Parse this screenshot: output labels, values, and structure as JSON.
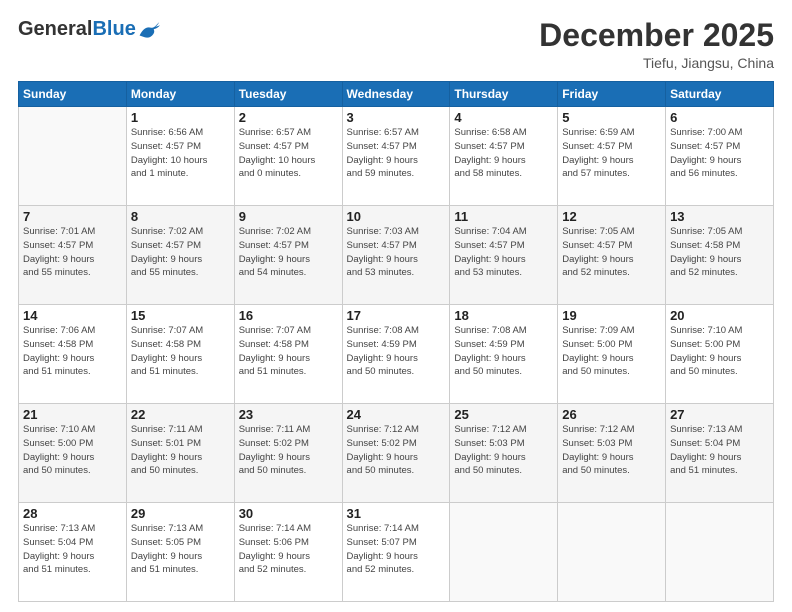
{
  "header": {
    "logo_general": "General",
    "logo_blue": "Blue",
    "month_title": "December 2025",
    "location": "Tiefu, Jiangsu, China"
  },
  "weekdays": [
    "Sunday",
    "Monday",
    "Tuesday",
    "Wednesday",
    "Thursday",
    "Friday",
    "Saturday"
  ],
  "weeks": [
    [
      {
        "num": "",
        "info": ""
      },
      {
        "num": "1",
        "info": "Sunrise: 6:56 AM\nSunset: 4:57 PM\nDaylight: 10 hours\nand 1 minute."
      },
      {
        "num": "2",
        "info": "Sunrise: 6:57 AM\nSunset: 4:57 PM\nDaylight: 10 hours\nand 0 minutes."
      },
      {
        "num": "3",
        "info": "Sunrise: 6:57 AM\nSunset: 4:57 PM\nDaylight: 9 hours\nand 59 minutes."
      },
      {
        "num": "4",
        "info": "Sunrise: 6:58 AM\nSunset: 4:57 PM\nDaylight: 9 hours\nand 58 minutes."
      },
      {
        "num": "5",
        "info": "Sunrise: 6:59 AM\nSunset: 4:57 PM\nDaylight: 9 hours\nand 57 minutes."
      },
      {
        "num": "6",
        "info": "Sunrise: 7:00 AM\nSunset: 4:57 PM\nDaylight: 9 hours\nand 56 minutes."
      }
    ],
    [
      {
        "num": "7",
        "info": "Sunrise: 7:01 AM\nSunset: 4:57 PM\nDaylight: 9 hours\nand 55 minutes."
      },
      {
        "num": "8",
        "info": "Sunrise: 7:02 AM\nSunset: 4:57 PM\nDaylight: 9 hours\nand 55 minutes."
      },
      {
        "num": "9",
        "info": "Sunrise: 7:02 AM\nSunset: 4:57 PM\nDaylight: 9 hours\nand 54 minutes."
      },
      {
        "num": "10",
        "info": "Sunrise: 7:03 AM\nSunset: 4:57 PM\nDaylight: 9 hours\nand 53 minutes."
      },
      {
        "num": "11",
        "info": "Sunrise: 7:04 AM\nSunset: 4:57 PM\nDaylight: 9 hours\nand 53 minutes."
      },
      {
        "num": "12",
        "info": "Sunrise: 7:05 AM\nSunset: 4:57 PM\nDaylight: 9 hours\nand 52 minutes."
      },
      {
        "num": "13",
        "info": "Sunrise: 7:05 AM\nSunset: 4:58 PM\nDaylight: 9 hours\nand 52 minutes."
      }
    ],
    [
      {
        "num": "14",
        "info": "Sunrise: 7:06 AM\nSunset: 4:58 PM\nDaylight: 9 hours\nand 51 minutes."
      },
      {
        "num": "15",
        "info": "Sunrise: 7:07 AM\nSunset: 4:58 PM\nDaylight: 9 hours\nand 51 minutes."
      },
      {
        "num": "16",
        "info": "Sunrise: 7:07 AM\nSunset: 4:58 PM\nDaylight: 9 hours\nand 51 minutes."
      },
      {
        "num": "17",
        "info": "Sunrise: 7:08 AM\nSunset: 4:59 PM\nDaylight: 9 hours\nand 50 minutes."
      },
      {
        "num": "18",
        "info": "Sunrise: 7:08 AM\nSunset: 4:59 PM\nDaylight: 9 hours\nand 50 minutes."
      },
      {
        "num": "19",
        "info": "Sunrise: 7:09 AM\nSunset: 5:00 PM\nDaylight: 9 hours\nand 50 minutes."
      },
      {
        "num": "20",
        "info": "Sunrise: 7:10 AM\nSunset: 5:00 PM\nDaylight: 9 hours\nand 50 minutes."
      }
    ],
    [
      {
        "num": "21",
        "info": "Sunrise: 7:10 AM\nSunset: 5:00 PM\nDaylight: 9 hours\nand 50 minutes."
      },
      {
        "num": "22",
        "info": "Sunrise: 7:11 AM\nSunset: 5:01 PM\nDaylight: 9 hours\nand 50 minutes."
      },
      {
        "num": "23",
        "info": "Sunrise: 7:11 AM\nSunset: 5:02 PM\nDaylight: 9 hours\nand 50 minutes."
      },
      {
        "num": "24",
        "info": "Sunrise: 7:12 AM\nSunset: 5:02 PM\nDaylight: 9 hours\nand 50 minutes."
      },
      {
        "num": "25",
        "info": "Sunrise: 7:12 AM\nSunset: 5:03 PM\nDaylight: 9 hours\nand 50 minutes."
      },
      {
        "num": "26",
        "info": "Sunrise: 7:12 AM\nSunset: 5:03 PM\nDaylight: 9 hours\nand 50 minutes."
      },
      {
        "num": "27",
        "info": "Sunrise: 7:13 AM\nSunset: 5:04 PM\nDaylight: 9 hours\nand 51 minutes."
      }
    ],
    [
      {
        "num": "28",
        "info": "Sunrise: 7:13 AM\nSunset: 5:04 PM\nDaylight: 9 hours\nand 51 minutes."
      },
      {
        "num": "29",
        "info": "Sunrise: 7:13 AM\nSunset: 5:05 PM\nDaylight: 9 hours\nand 51 minutes."
      },
      {
        "num": "30",
        "info": "Sunrise: 7:14 AM\nSunset: 5:06 PM\nDaylight: 9 hours\nand 52 minutes."
      },
      {
        "num": "31",
        "info": "Sunrise: 7:14 AM\nSunset: 5:07 PM\nDaylight: 9 hours\nand 52 minutes."
      },
      {
        "num": "",
        "info": ""
      },
      {
        "num": "",
        "info": ""
      },
      {
        "num": "",
        "info": ""
      }
    ]
  ]
}
